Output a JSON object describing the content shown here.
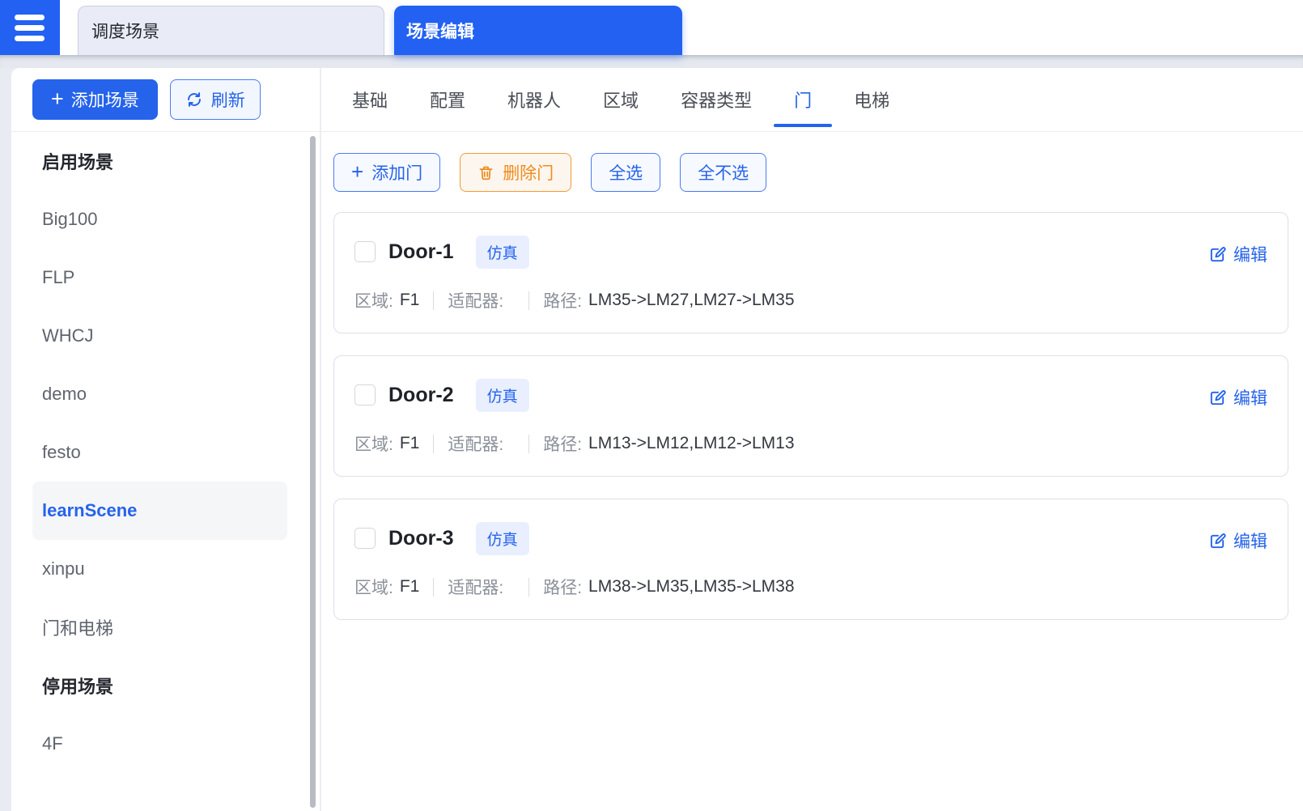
{
  "topbar": {
    "tabs": [
      {
        "label": "调度场景",
        "active": false
      },
      {
        "label": "场景编辑",
        "active": true
      }
    ]
  },
  "sidebar": {
    "add_button_label": "添加场景",
    "refresh_button_label": "刷新",
    "items": [
      {
        "type": "header",
        "label": "启用场景"
      },
      {
        "type": "item",
        "label": "Big100"
      },
      {
        "type": "item",
        "label": "FLP"
      },
      {
        "type": "item",
        "label": "WHCJ"
      },
      {
        "type": "item",
        "label": "demo"
      },
      {
        "type": "item",
        "label": "festo"
      },
      {
        "type": "item",
        "label": "learnScene",
        "active": true
      },
      {
        "type": "item",
        "label": "xinpu"
      },
      {
        "type": "item",
        "label": "门和电梯"
      },
      {
        "type": "header",
        "label": "停用场景"
      },
      {
        "type": "item",
        "label": "4F"
      }
    ]
  },
  "main": {
    "tabs": [
      {
        "label": "基础"
      },
      {
        "label": "配置"
      },
      {
        "label": "机器人"
      },
      {
        "label": "区域"
      },
      {
        "label": "容器类型"
      },
      {
        "label": "门",
        "active": true
      },
      {
        "label": "电梯"
      }
    ],
    "actions": {
      "add_door": "添加门",
      "delete_door": "删除门",
      "select_all": "全选",
      "select_none": "全不选"
    },
    "door_labels": {
      "badge": "仿真",
      "edit": "编辑",
      "area": "区域:",
      "adapter": "适配器:",
      "path": "路径:"
    },
    "doors": [
      {
        "name": "Door-1",
        "area": "F1",
        "adapter": "",
        "path": "LM35->LM27,LM27->LM35"
      },
      {
        "name": "Door-2",
        "area": "F1",
        "adapter": "",
        "path": "LM13->LM12,LM12->LM13"
      },
      {
        "name": "Door-3",
        "area": "F1",
        "adapter": "",
        "path": "LM38->LM35,LM35->LM38"
      }
    ]
  },
  "colors": {
    "primary_blue": "#2563eb",
    "topbar_blue": "#2261f2",
    "orange": "#ef8b1d",
    "badge_bg": "#e9effe"
  }
}
